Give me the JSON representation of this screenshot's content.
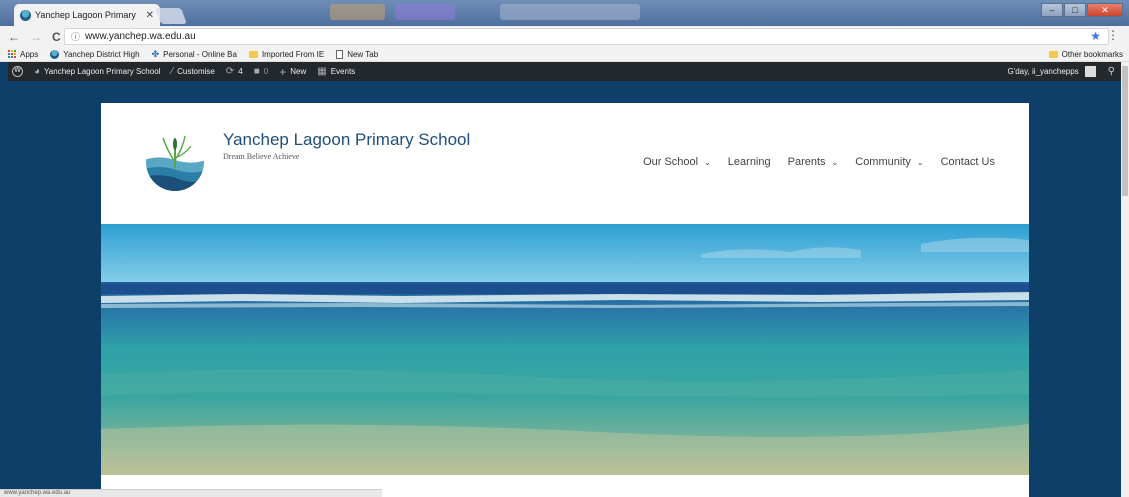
{
  "browser": {
    "tab_title": "Yanchep Lagoon Primary",
    "url": "www.yanchep.wa.edu.au",
    "bookmarks": [
      {
        "label": "Apps",
        "icon": "apps-grid-icon"
      },
      {
        "label": "Yanchep District High",
        "icon": "school-favicon-icon"
      },
      {
        "label": "Personal - Online Ba",
        "icon": "bank-favicon-icon"
      },
      {
        "label": "Imported From IE",
        "icon": "folder-icon"
      },
      {
        "label": "New Tab",
        "icon": "page-icon"
      }
    ],
    "other_bookmarks": "Other bookmarks",
    "status_url": "www.yanchep.wa.edu.au"
  },
  "admin_bar": {
    "site_name": "Yanchep Lagoon Primary School",
    "customise": "Customise",
    "updates_count": "4",
    "comments_count": "0",
    "new_label": "New",
    "events_label": "Events",
    "greeting": "G'day, ii_yanchepps"
  },
  "site": {
    "title": "Yanchep Lagoon Primary School",
    "tagline": "Dream Believe Achieve",
    "nav": [
      {
        "label": "Our School",
        "has_dropdown": true
      },
      {
        "label": "Learning",
        "has_dropdown": false
      },
      {
        "label": "Parents",
        "has_dropdown": true
      },
      {
        "label": "Community",
        "has_dropdown": true
      },
      {
        "label": "Contact Us",
        "has_dropdown": false
      }
    ]
  },
  "colors": {
    "page_background": "#0d3f68",
    "admin_bar": "#23282d",
    "title_text": "#1f4e79"
  }
}
